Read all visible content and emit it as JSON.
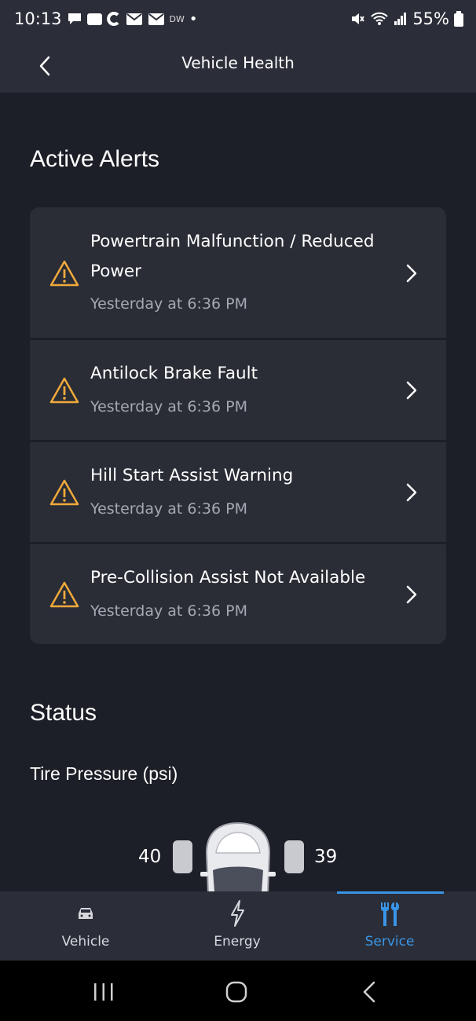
{
  "status_bar": {
    "time": "10:13",
    "battery": "55%",
    "left_icons": [
      "chat-bubble-icon",
      "ford-app-icon",
      "c-app-icon",
      "mail-icon",
      "mail-icon"
    ],
    "dw": "DW",
    "dot": "•"
  },
  "header": {
    "title": "Vehicle Health"
  },
  "active_alerts": {
    "title": "Active Alerts",
    "items": [
      {
        "title": "Powertrain Malfunction / Reduced Power",
        "time": "Yesterday at 6:36 PM"
      },
      {
        "title": "Antilock Brake Fault",
        "time": "Yesterday at 6:36 PM"
      },
      {
        "title": "Hill Start Assist Warning",
        "time": "Yesterday at 6:36 PM"
      },
      {
        "title": "Pre-Collision Assist Not Available",
        "time": "Yesterday at 6:36 PM"
      }
    ]
  },
  "status": {
    "title": "Status",
    "tire_pressure_label": "Tire Pressure (psi)",
    "front_left": "40",
    "front_right": "39"
  },
  "bottom_nav": {
    "items": [
      {
        "label": "Vehicle",
        "icon": "car-icon"
      },
      {
        "label": "Energy",
        "icon": "lightning-icon"
      },
      {
        "label": "Service",
        "icon": "wrench-tools-icon",
        "active": true
      }
    ]
  },
  "colors": {
    "background": "#1c1f27",
    "card": "#2a2d36",
    "warning": "#f0a93b",
    "accent": "#3a95e8"
  }
}
